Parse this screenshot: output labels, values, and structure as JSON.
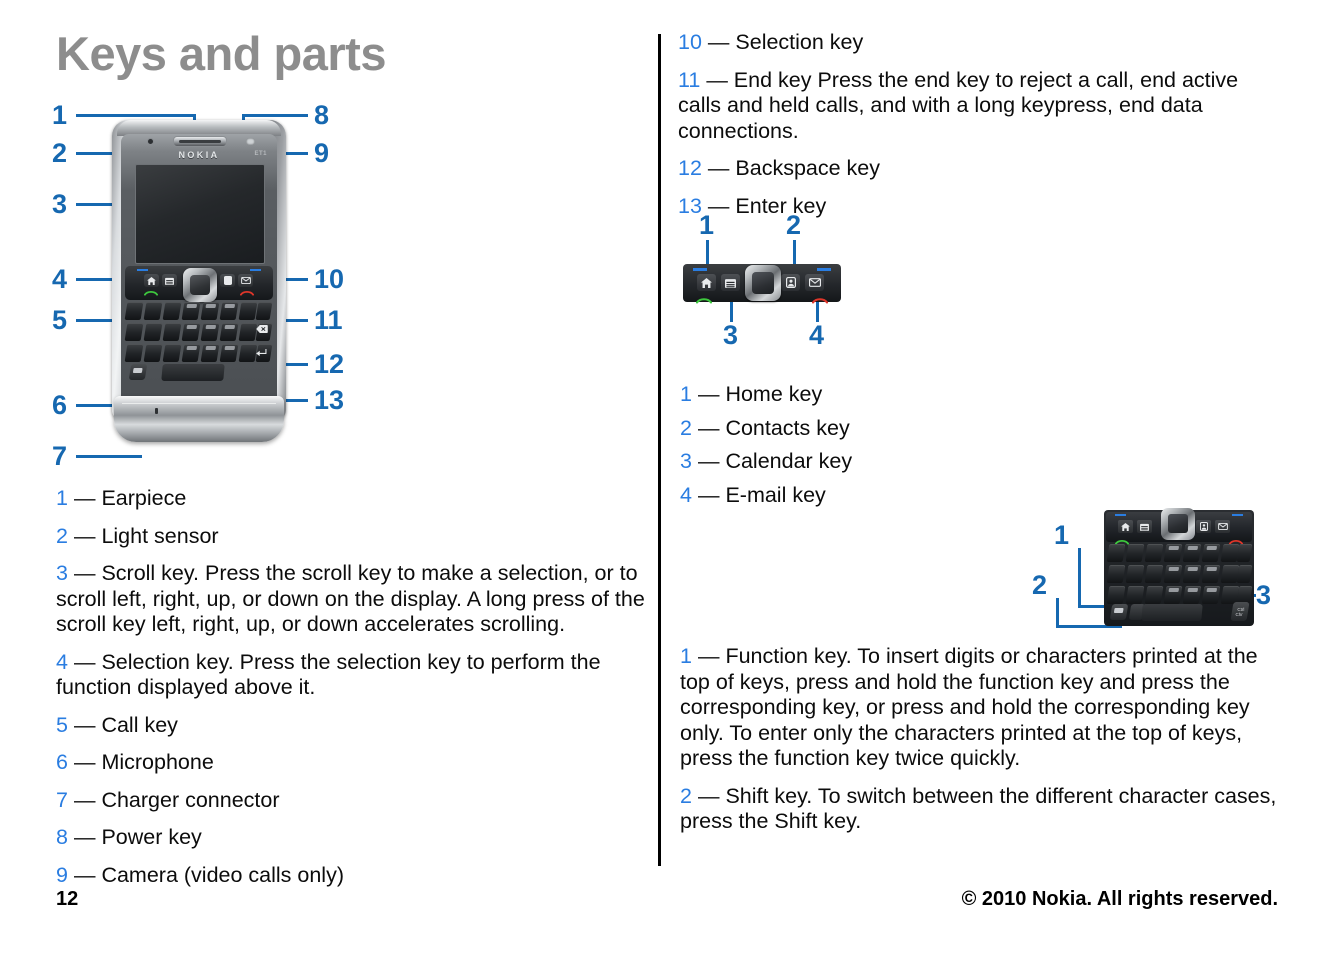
{
  "title": "Keys and parts",
  "left_column": {
    "diagram": {
      "name": "front-view-phone-diagram",
      "device_brand": "NOKIA",
      "device_model": "ET1",
      "callouts": [
        "1",
        "2",
        "3",
        "4",
        "5",
        "6",
        "7",
        "8",
        "9",
        "10",
        "11",
        "12",
        "13"
      ]
    },
    "items": [
      {
        "num": "1",
        "dash": "—",
        "text": "Earpiece"
      },
      {
        "num": "2",
        "dash": "—",
        "text": "Light sensor"
      },
      {
        "num": "3",
        "dash": "—",
        "text": "Scroll key. Press the scroll key to make a selection, or to scroll left, right, up, or down on the display. A long press of the scroll key left, right, up, or down accelerates scrolling."
      },
      {
        "num": "4",
        "dash": "—",
        "text": "Selection key. Press the selection key to perform the function displayed above it."
      },
      {
        "num": "5",
        "dash": "—",
        "text": "Call key"
      },
      {
        "num": "6",
        "dash": "—",
        "text": "Microphone"
      },
      {
        "num": "7",
        "dash": "—",
        "text": "Charger connector"
      },
      {
        "num": "8",
        "dash": "—",
        "text": "Power key"
      },
      {
        "num": "9",
        "dash": "—",
        "text": "Camera (video calls only)"
      }
    ]
  },
  "right_column": {
    "items_top": [
      {
        "num": "10",
        "dash": "—",
        "text": "Selection key"
      },
      {
        "num": "11",
        "dash": "—",
        "text": "End key Press the end key to reject a call, end active calls and held calls, and with a long keypress, end data connections."
      },
      {
        "num": "12",
        "dash": "—",
        "text": "Backspace key"
      },
      {
        "num": "13",
        "dash": "—",
        "text": "Enter key"
      }
    ],
    "strip_diagram": {
      "name": "function-key-strip-diagram",
      "callouts": [
        "1",
        "2",
        "3",
        "4"
      ]
    },
    "items_mid": [
      {
        "num": "1",
        "dash": "—",
        "text": "Home key"
      },
      {
        "num": "2",
        "dash": "—",
        "text": "Contacts key"
      },
      {
        "num": "3",
        "dash": "—",
        "text": "Calendar key"
      },
      {
        "num": "4",
        "dash": "—",
        "text": "E-mail key"
      }
    ],
    "keypad_diagram": {
      "name": "keypad-diagram",
      "callouts": [
        "1",
        "2",
        "3"
      ],
      "ctrl_label_top": "Ctrl",
      "ctrl_label_bottom": "Chr"
    },
    "items_bottom": [
      {
        "num": "1",
        "dash": "—",
        "text": "Function key. To insert digits or characters printed at the top of keys, press and hold the function key and press the corresponding key, or press and hold the corresponding key only. To enter only the characters printed at the top of keys, press the function key twice quickly."
      },
      {
        "num": "2",
        "dash": "—",
        "text": "Shift key. To switch between the different character cases, press the Shift key."
      }
    ]
  },
  "footer": {
    "page_number": "12",
    "copyright": "© 2010 Nokia. All rights reserved."
  },
  "colors": {
    "title_gray": "#8d8d8d",
    "list_number_blue": "#2a7de1",
    "callout_blue": "#1668b0",
    "text_black": "#0c0c0c"
  }
}
